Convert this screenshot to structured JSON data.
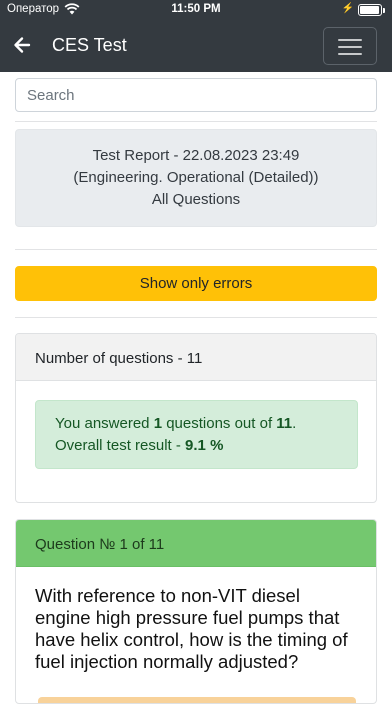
{
  "status_bar": {
    "carrier": "Оператор",
    "time": "11:50 PM",
    "battery_level": 0.95
  },
  "navbar": {
    "title": "CES Test"
  },
  "search": {
    "placeholder": "Search"
  },
  "report": {
    "line1": "Test Report - 22.08.2023 23:49",
    "line2": "(Engineering. Operational (Detailed))",
    "line3": "All Questions"
  },
  "errors_button": {
    "label": "Show only errors"
  },
  "summary": {
    "header": "Number of questions - 11",
    "text_prefix": "You answered ",
    "answered": "1",
    "text_middle": " questions out of ",
    "total": "11",
    "text_end": ".",
    "result_label": "Overall test result - ",
    "result_value": "9.1 %"
  },
  "question": {
    "header": "Question № 1 of 11",
    "text": "With reference to non-VIT diesel engine high pressure fuel pumps that have helix control, how is the timing of fuel injection normally adjusted?"
  },
  "colors": {
    "navbar": "#343a40",
    "warning": "#ffc107",
    "success_bg": "#d4edda",
    "question_header": "#74c86f"
  }
}
